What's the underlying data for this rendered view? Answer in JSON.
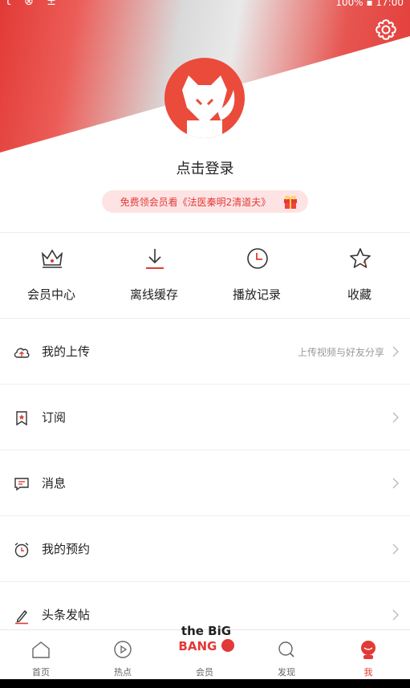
{
  "status_bar": {
    "left": "t ⊗ ±",
    "right": "100% ▪ 17:00"
  },
  "icons": {
    "settings": "gear-icon",
    "avatar": "fox-avatar-icon",
    "gift": "gift-icon"
  },
  "profile": {
    "login_label": "点击登录",
    "promo_text": "免费领会员看《法医秦明2清道夫》"
  },
  "quick_actions": [
    {
      "label": "会员中心",
      "icon": "crown-icon"
    },
    {
      "label": "离线缓存",
      "icon": "download-icon"
    },
    {
      "label": "播放记录",
      "icon": "clock-history-icon"
    },
    {
      "label": "收藏",
      "icon": "star-icon"
    }
  ],
  "menu": [
    {
      "label": "我的上传",
      "hint": "上传视频与好友分享",
      "icon": "cloud-upload-icon"
    },
    {
      "label": "订阅",
      "hint": "",
      "icon": "bookmark-icon"
    },
    {
      "label": "消息",
      "hint": "",
      "icon": "message-icon"
    },
    {
      "label": "我的预约",
      "hint": "",
      "icon": "alarm-icon"
    },
    {
      "label": "头条发帖",
      "hint": "",
      "icon": "pen-icon"
    }
  ],
  "tabbar": {
    "items": [
      {
        "label": "首页",
        "icon": "home-icon"
      },
      {
        "label": "热点",
        "icon": "play-circle-icon"
      },
      {
        "label": "会员",
        "icon": "the-big-bang-logo"
      },
      {
        "label": "发现",
        "icon": "search-icon"
      },
      {
        "label": "我",
        "icon": "user-icon"
      }
    ],
    "active_index": 4,
    "logo_text": {
      "line1": "the BiG",
      "line2": "BANG"
    }
  },
  "colors": {
    "accent": "#e23a36",
    "promo_bg": "#fde3e3",
    "text": "#222222",
    "muted": "#999999"
  }
}
